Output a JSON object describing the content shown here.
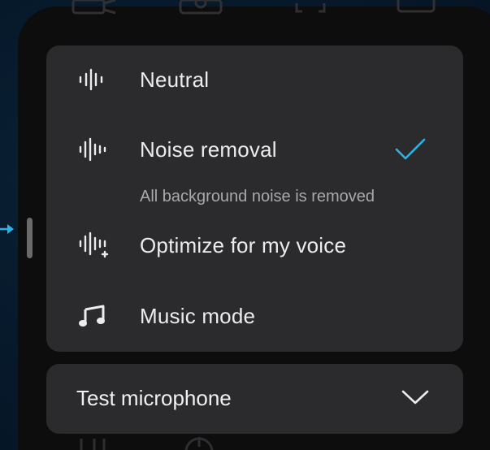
{
  "menu": {
    "items": [
      {
        "label": "Neutral",
        "icon": "audio-waveform-icon",
        "selected": false
      },
      {
        "label": "Noise removal",
        "icon": "audio-waveform-icon",
        "selected": true,
        "description": "All background noise is removed"
      },
      {
        "label": "Optimize for my voice",
        "icon": "audio-waveform-plus-icon",
        "selected": false
      },
      {
        "label": "Music mode",
        "icon": "music-note-icon",
        "selected": false
      }
    ]
  },
  "test_microphone": {
    "label": "Test microphone",
    "icon": "chevron-down-icon"
  },
  "colors": {
    "accent": "#2bb3e6",
    "card_bg": "#2b2b2d",
    "device_bg": "#0d0d0e",
    "background": "#07192a"
  }
}
